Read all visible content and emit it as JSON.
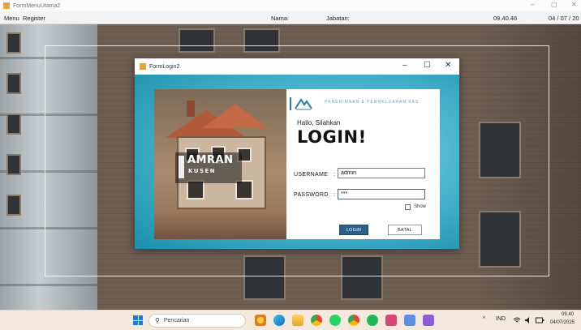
{
  "main_window": {
    "title": "FormMenuUtama2",
    "controls": {
      "minimize": "–",
      "maximize": "▢",
      "close": "✕"
    },
    "menu": [
      "Menu",
      "Register"
    ],
    "status": {
      "nama_label": "Nama:",
      "jabatan_label": "Jabatan:",
      "time": "09.40.46",
      "date": "04 / 07 / 20"
    }
  },
  "dialog": {
    "title": "FormLogin2",
    "controls": {
      "minimize": "–",
      "maximize": "☐",
      "close": "✕"
    },
    "brand": {
      "main": "AMRAN",
      "sub": "KUSEN"
    },
    "header_text": "PENERIMAAN & PENGELUARAN KAS",
    "greeting": "Hallo, Silahkan",
    "heading": "LOGIN!",
    "username_label": "USERNAME",
    "password_label": "PASSWORD",
    "colon": ":",
    "username_value": "admin",
    "password_value": "***",
    "show_label": "Show",
    "show_checked": false,
    "login_button": "LOGIN",
    "cancel_button": "BATAL"
  },
  "taskbar": {
    "search_placeholder": "Pencarian",
    "apps": [
      "weather-icon",
      "edge-icon",
      "file-explorer-icon",
      "chrome-icon",
      "whatsapp-icon",
      "chrome-icon",
      "spotify-icon",
      "calendar-app-icon",
      "link-app-icon",
      "visual-studio-icon"
    ],
    "tray": {
      "chevron": "^",
      "language": "IND",
      "time": "09.40",
      "date": "04/07/2025"
    }
  },
  "colors": {
    "dialog_accent": "#1d98b4",
    "login_button": "#2b5f86",
    "logo": "#1f7fa0",
    "taskbar": "#f4e9dc"
  }
}
